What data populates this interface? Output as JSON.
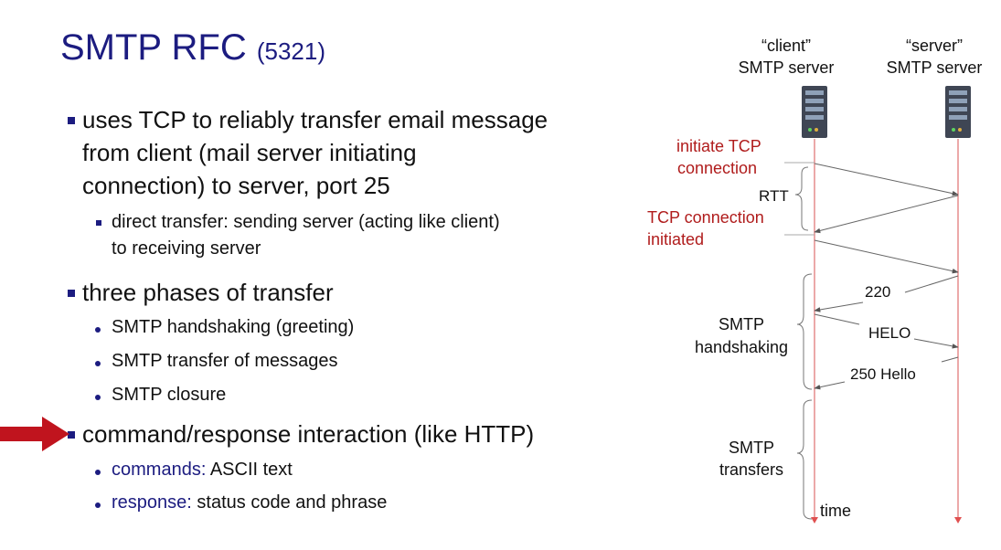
{
  "title": {
    "main": "SMTP RFC",
    "sub": "(5321)"
  },
  "bullets": {
    "b1": {
      "line1": "uses TCP to reliably transfer email message",
      "line2": "from client (mail server initiating",
      "line3": "connection) to server, port 25",
      "sub1": {
        "line1": "direct transfer: sending server (acting like client)",
        "line2": "to receiving server"
      }
    },
    "b2": {
      "text": "three phases of transfer",
      "items": [
        "SMTP handshaking (greeting)",
        "SMTP transfer of messages",
        "SMTP closure"
      ]
    },
    "b3": {
      "text": "command/response interaction (like HTTP)",
      "items": [
        {
          "key": "commands:",
          "rest": " ASCII text"
        },
        {
          "key": "response:",
          "rest": " status code and phrase"
        }
      ]
    }
  },
  "diagram": {
    "client_line1": "“client”",
    "client_line2": "SMTP server",
    "server_line1": "“server”",
    "server_line2": "SMTP server",
    "initiate_line1": "initiate TCP",
    "initiate_line2": "connection",
    "rtt": "RTT",
    "initiated_line1": "TCP connection",
    "initiated_line2": "initiated",
    "msg_220": "220",
    "msg_helo": "HELO",
    "msg_250": "250 Hello",
    "handshaking_line1": "SMTP",
    "handshaking_line2": "handshaking",
    "transfers_line1": "SMTP",
    "transfers_line2": "transfers",
    "time": "time"
  },
  "colors": {
    "title": "#1c1c80",
    "bullet": "#1c1c80",
    "red_label": "#b01c1c",
    "timeline": "#e05050",
    "arrow_pointer": "#c0141e"
  },
  "icons": [
    "server-icon",
    "server-icon",
    "pointer-arrow-icon"
  ]
}
